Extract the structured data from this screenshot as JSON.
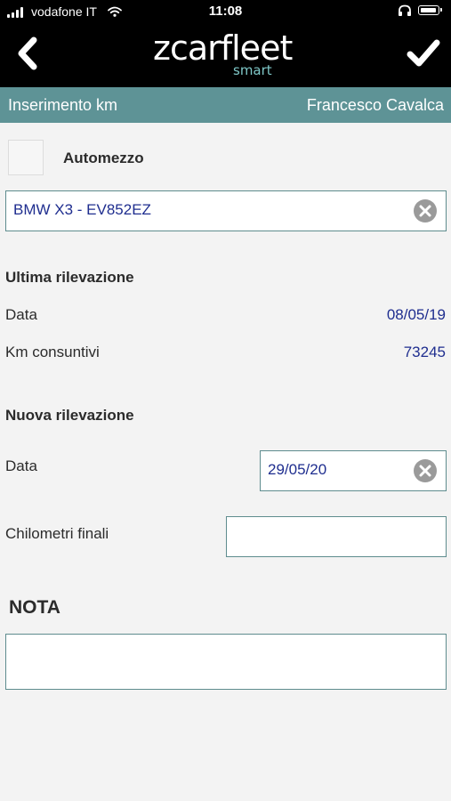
{
  "status_bar": {
    "carrier": "vodafone IT",
    "time": "11:08",
    "icons": [
      "signal-icon",
      "wifi-icon",
      "headphones-icon",
      "battery-icon"
    ]
  },
  "header": {
    "logo_main": "zcarfleet",
    "logo_sub": "smart",
    "back_icon": "chevron-left-icon",
    "confirm_icon": "checkmark-icon"
  },
  "subheader": {
    "title": "Inserimento km",
    "user": "Francesco Cavalca"
  },
  "vehicle": {
    "label": "Automezzo",
    "value": "BMW X3 - EV852EZ"
  },
  "last_reading": {
    "heading": "Ultima rilevazione",
    "date_label": "Data",
    "date_value": "08/05/19",
    "km_label": "Km consuntivi",
    "km_value": "73245"
  },
  "new_reading": {
    "heading": "Nuova rilevazione",
    "date_label": "Data",
    "date_value": "29/05/20",
    "km_label": "Chilometri finali",
    "km_value": ""
  },
  "note": {
    "label": "NOTA",
    "value": ""
  },
  "colors": {
    "header_bg": "#000000",
    "subheader_bg": "#5e9396",
    "value_text": "#1f2e8f",
    "field_border": "#5e8c8e",
    "page_bg": "#f3f3f3"
  }
}
